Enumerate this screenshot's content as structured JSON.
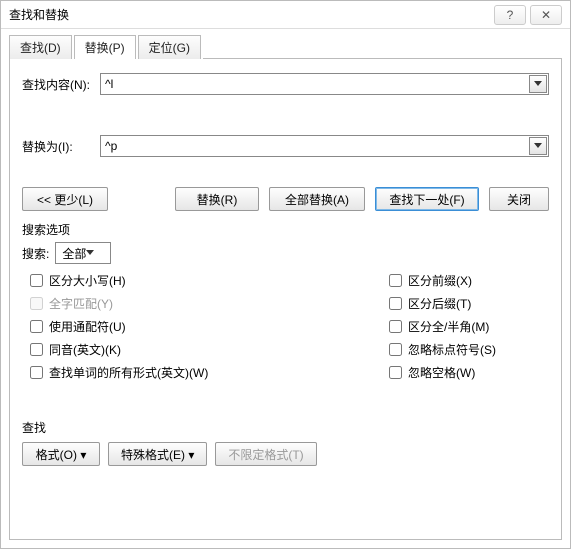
{
  "title": "查找和替换",
  "titlebar": {
    "help": "?",
    "close": "✕"
  },
  "tabs": {
    "find": "查找(D)",
    "replace": "替换(P)",
    "goto": "定位(G)"
  },
  "fields": {
    "find_label": "查找内容(N):",
    "find_value": "^l",
    "replace_label": "替换为(I):",
    "replace_value": "^p"
  },
  "buttons": {
    "less": "<< 更少(L)",
    "replace": "替换(R)",
    "replace_all": "全部替换(A)",
    "find_next": "查找下一处(F)",
    "close": "关闭"
  },
  "options": {
    "section": "搜索选项",
    "search_label": "搜索:",
    "search_value": "全部",
    "left": {
      "match_case": "区分大小写(H)",
      "whole_word": "全字匹配(Y)",
      "wildcards": "使用通配符(U)",
      "sounds_like": "同音(英文)(K)",
      "all_forms": "查找单词的所有形式(英文)(W)"
    },
    "right": {
      "prefix": "区分前缀(X)",
      "suffix": "区分后缀(T)",
      "full_half": "区分全/半角(M)",
      "ignore_punct": "忽略标点符号(S)",
      "ignore_space": "忽略空格(W)"
    }
  },
  "bottom": {
    "section": "查找",
    "format": "格式(O) ▾",
    "special": "特殊格式(E) ▾",
    "no_format": "不限定格式(T)"
  }
}
